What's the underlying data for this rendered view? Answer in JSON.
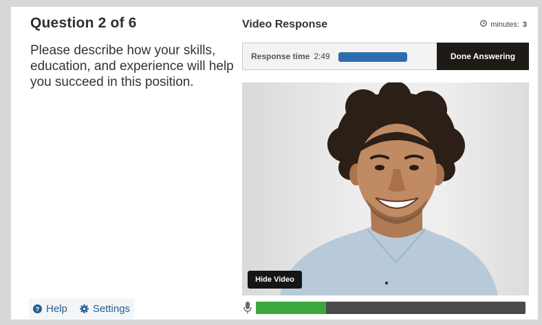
{
  "question": {
    "title": "Question 2 of 6",
    "text": "Please describe how your skills, education, and experience will help you succeed in this position."
  },
  "response": {
    "heading": "Video Response",
    "minutes_label": "minutes:",
    "minutes_value": "3",
    "response_time_label": "Response time",
    "response_time_value": "2:49",
    "response_progress": 1.0,
    "done_button": "Done Answering",
    "hide_video_button": "Hide Video",
    "mic_level": 0.26
  },
  "footer": {
    "help": "Help",
    "settings": "Settings"
  },
  "colors": {
    "accent_blue": "#2b6eb0",
    "link_blue": "#2a5d8f",
    "dark_button": "#1e1a16",
    "mic_green": "#3aa83a",
    "mic_track": "#4a4a4a"
  },
  "icons": [
    "clock-icon",
    "help-icon",
    "gear-icon",
    "microphone-icon"
  ]
}
